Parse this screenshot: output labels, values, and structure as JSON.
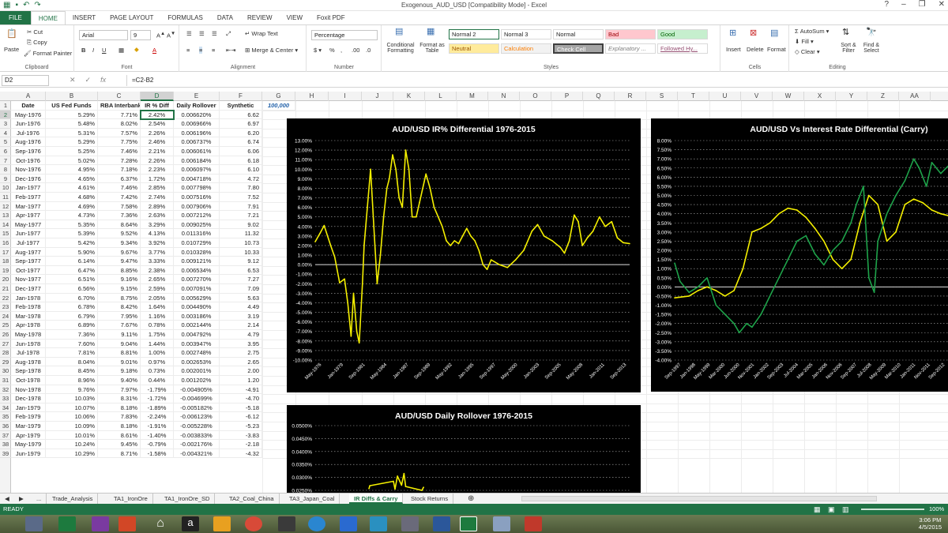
{
  "window": {
    "title": "Exogenous_AUD_USD  [Compatibility Mode] - Excel"
  },
  "ribbon_tabs": [
    "FILE",
    "HOME",
    "INSERT",
    "PAGE LAYOUT",
    "FORMULAS",
    "DATA",
    "REVIEW",
    "VIEW",
    "Foxit PDF"
  ],
  "ribbon": {
    "clipboard": {
      "paste": "Paste",
      "cut": "Cut",
      "copy": "Copy",
      "format_painter": "Format Painter",
      "label": "Clipboard"
    },
    "font": {
      "name": "Arial",
      "size": "9",
      "label": "Font"
    },
    "alignment": {
      "wrap": "Wrap Text",
      "merge": "Merge & Center",
      "label": "Alignment"
    },
    "number": {
      "format": "Percentage",
      "label": "Number"
    },
    "styles": {
      "conditional": "Conditional Formatting",
      "format_as_table": "Format as Table",
      "label": "Styles",
      "items": [
        {
          "name": "Normal 2",
          "bg": "#ffffff",
          "fg": "#222222"
        },
        {
          "name": "Normal 3",
          "bg": "#ffffff",
          "fg": "#222222"
        },
        {
          "name": "Normal",
          "bg": "#ffffff",
          "fg": "#222222"
        },
        {
          "name": "Bad",
          "bg": "#ffc7ce",
          "fg": "#9c0006"
        },
        {
          "name": "Good",
          "bg": "#c6efce",
          "fg": "#006100"
        },
        {
          "name": "Neutral",
          "bg": "#ffeb9c",
          "fg": "#9c5700"
        },
        {
          "name": "Calculation",
          "bg": "#f2f2f2",
          "fg": "#fa7d00"
        },
        {
          "name": "Check Cell",
          "bg": "#a5a5a5",
          "fg": "#ffffff"
        },
        {
          "name": "Explanatory ...",
          "bg": "#ffffff",
          "fg": "#7f7f7f"
        },
        {
          "name": "Followed Hy...",
          "bg": "#ffffff",
          "fg": "#954f72"
        }
      ]
    },
    "cells": {
      "insert": "Insert",
      "delete": "Delete",
      "format": "Format",
      "label": "Cells"
    },
    "editing": {
      "autosum": "AutoSum",
      "fill": "Fill",
      "clear": "Clear",
      "sort": "Sort & Filter",
      "find": "Find & Select",
      "label": "Editing"
    }
  },
  "formula_bar": {
    "name_box": "D2",
    "formula": "=C2-B2"
  },
  "columns": [
    "A",
    "B",
    "C",
    "D",
    "E",
    "F",
    "G",
    "H",
    "I",
    "J",
    "K",
    "L",
    "M",
    "N",
    "O",
    "P",
    "Q",
    "R",
    "S",
    "T",
    "U",
    "V",
    "W",
    "X",
    "Y",
    "Z",
    "AA"
  ],
  "header_row": [
    "Date",
    "US Fed Funds",
    "RBA Interbank",
    "IR % Diff",
    "Daily Rollover",
    "Synthetic",
    "100,000"
  ],
  "rows": [
    [
      "May-1976",
      "5.29%",
      "7.71%",
      "2.42%",
      "0.006620%",
      "6.62"
    ],
    [
      "Jun-1976",
      "5.48%",
      "8.02%",
      "2.54%",
      "0.006966%",
      "6.97"
    ],
    [
      "Jul-1976",
      "5.31%",
      "7.57%",
      "2.26%",
      "0.006196%",
      "6.20"
    ],
    [
      "Aug-1976",
      "5.29%",
      "7.75%",
      "2.46%",
      "0.006737%",
      "6.74"
    ],
    [
      "Sep-1976",
      "5.25%",
      "7.46%",
      "2.21%",
      "0.006061%",
      "6.06"
    ],
    [
      "Oct-1976",
      "5.02%",
      "7.28%",
      "2.26%",
      "0.006184%",
      "6.18"
    ],
    [
      "Nov-1976",
      "4.95%",
      "7.18%",
      "2.23%",
      "0.006097%",
      "6.10"
    ],
    [
      "Dec-1976",
      "4.65%",
      "6.37%",
      "1.72%",
      "0.004718%",
      "4.72"
    ],
    [
      "Jan-1977",
      "4.61%",
      "7.46%",
      "2.85%",
      "0.007798%",
      "7.80"
    ],
    [
      "Feb-1977",
      "4.68%",
      "7.42%",
      "2.74%",
      "0.007516%",
      "7.52"
    ],
    [
      "Mar-1977",
      "4.69%",
      "7.58%",
      "2.89%",
      "0.007906%",
      "7.91"
    ],
    [
      "Apr-1977",
      "4.73%",
      "7.36%",
      "2.63%",
      "0.007212%",
      "7.21"
    ],
    [
      "May-1977",
      "5.35%",
      "8.64%",
      "3.29%",
      "0.009025%",
      "9.02"
    ],
    [
      "Jun-1977",
      "5.39%",
      "9.52%",
      "4.13%",
      "0.011316%",
      "11.32"
    ],
    [
      "Jul-1977",
      "5.42%",
      "9.34%",
      "3.92%",
      "0.010729%",
      "10.73"
    ],
    [
      "Aug-1977",
      "5.90%",
      "9.67%",
      "3.77%",
      "0.010328%",
      "10.33"
    ],
    [
      "Sep-1977",
      "6.14%",
      "9.47%",
      "3.33%",
      "0.009121%",
      "9.12"
    ],
    [
      "Oct-1977",
      "6.47%",
      "8.85%",
      "2.38%",
      "0.006534%",
      "6.53"
    ],
    [
      "Nov-1977",
      "6.51%",
      "9.16%",
      "2.65%",
      "0.007270%",
      "7.27"
    ],
    [
      "Dec-1977",
      "6.56%",
      "9.15%",
      "2.59%",
      "0.007091%",
      "7.09"
    ],
    [
      "Jan-1978",
      "6.70%",
      "8.75%",
      "2.05%",
      "0.005629%",
      "5.63"
    ],
    [
      "Feb-1978",
      "6.78%",
      "8.42%",
      "1.64%",
      "0.004490%",
      "4.49"
    ],
    [
      "Mar-1978",
      "6.79%",
      "7.95%",
      "1.16%",
      "0.003186%",
      "3.19"
    ],
    [
      "Apr-1978",
      "6.89%",
      "7.67%",
      "0.78%",
      "0.002144%",
      "2.14"
    ],
    [
      "May-1978",
      "7.36%",
      "9.11%",
      "1.75%",
      "0.004792%",
      "4.79"
    ],
    [
      "Jun-1978",
      "7.60%",
      "9.04%",
      "1.44%",
      "0.003947%",
      "3.95"
    ],
    [
      "Jul-1978",
      "7.81%",
      "8.81%",
      "1.00%",
      "0.002748%",
      "2.75"
    ],
    [
      "Aug-1978",
      "8.04%",
      "9.01%",
      "0.97%",
      "0.002653%",
      "2.65"
    ],
    [
      "Sep-1978",
      "8.45%",
      "9.18%",
      "0.73%",
      "0.002001%",
      "2.00"
    ],
    [
      "Oct-1978",
      "8.96%",
      "9.40%",
      "0.44%",
      "0.001202%",
      "1.20"
    ],
    [
      "Nov-1978",
      "9.76%",
      "7.97%",
      "-1.79%",
      "-0.004905%",
      "-4.91"
    ],
    [
      "Dec-1978",
      "10.03%",
      "8.31%",
      "-1.72%",
      "-0.004699%",
      "-4.70"
    ],
    [
      "Jan-1979",
      "10.07%",
      "8.18%",
      "-1.89%",
      "-0.005182%",
      "-5.18"
    ],
    [
      "Feb-1979",
      "10.06%",
      "7.83%",
      "-2.24%",
      "-0.006123%",
      "-6.12"
    ],
    [
      "Mar-1979",
      "10.09%",
      "8.18%",
      "-1.91%",
      "-0.005228%",
      "-5.23"
    ],
    [
      "Apr-1979",
      "10.01%",
      "8.61%",
      "-1.40%",
      "-0.003833%",
      "-3.83"
    ],
    [
      "May-1979",
      "10.24%",
      "9.45%",
      "-0.79%",
      "-0.002176%",
      "-2.18"
    ],
    [
      "Jun-1979",
      "10.29%",
      "8.71%",
      "-1.58%",
      "-0.004321%",
      "-4.32"
    ]
  ],
  "chart_data": [
    {
      "type": "line",
      "title": "AUD/USD IR% Differential 1976-2015",
      "ylim": [
        -10,
        13
      ],
      "yticks": [
        "13.00%",
        "12.00%",
        "11.00%",
        "10.00%",
        "9.00%",
        "8.00%",
        "7.00%",
        "6.00%",
        "5.00%",
        "4.00%",
        "3.00%",
        "2.00%",
        "1.00%",
        "0.00%",
        "-1.00%",
        "-2.00%",
        "-3.00%",
        "-4.00%",
        "-5.00%",
        "-6.00%",
        "-7.00%",
        "-8.00%",
        "-9.00%",
        "-10.00%"
      ],
      "xticks": [
        "May-1976",
        "Jan-1979",
        "Sep-1981",
        "May-1984",
        "Jan-1987",
        "Sep-1989",
        "May-1992",
        "Jan-1995",
        "Sep-1997",
        "May-2000",
        "Jan-2003",
        "Sep-2005",
        "May-2008",
        "Jan-2011",
        "Sep-2013"
      ],
      "series": [
        {
          "color": "#f5f000",
          "x": [
            1976.4,
            1977.0,
            1977.5,
            1978.3,
            1978.8,
            1979.4,
            1980.0,
            1980.4,
            1980.8,
            1981.1,
            1981.5,
            1981.8,
            1982.2,
            1982.4,
            1982.8,
            1983.2,
            1983.6,
            1984.0,
            1984.4,
            1984.8,
            1985.2,
            1985.5,
            1985.9,
            1986.3,
            1986.7,
            1987.1,
            1987.5,
            1987.9,
            1988.3,
            1988.8,
            1989.2,
            1989.6,
            1990.0,
            1990.5,
            1991.0,
            1991.5,
            1992.0,
            1992.5,
            1993.0,
            1993.5,
            1994.0,
            1994.5,
            1995.0,
            1995.5,
            1996.0,
            1996.5,
            1997.0,
            1997.5,
            1998.0,
            1999.0,
            2000.0,
            2001.0,
            2002.0,
            2003.0,
            2003.7,
            2004.5,
            2005.5,
            2006.5,
            2007.0,
            2007.6,
            2008.2,
            2008.7,
            2009.2,
            2009.8,
            2010.5,
            2011.3,
            2012.0,
            2012.8,
            2013.5,
            2014.2,
            2015.0
          ],
          "y": [
            2.4,
            3.3,
            4.1,
            2.0,
            0.8,
            -1.9,
            -1.5,
            -4.0,
            -7.5,
            -3.0,
            -7.0,
            -8.2,
            -2.0,
            2.0,
            6.0,
            10.0,
            4.0,
            -2.0,
            1.0,
            5.0,
            8.0,
            9.0,
            11.5,
            10.0,
            7.0,
            6.0,
            12.0,
            10.0,
            5.0,
            5.0,
            6.5,
            8.0,
            9.5,
            8.0,
            6.0,
            5.0,
            4.0,
            2.5,
            2.0,
            2.5,
            2.2,
            3.0,
            3.8,
            3.0,
            2.5,
            1.5,
            0.0,
            -0.5,
            0.5,
            0.0,
            -0.3,
            0.5,
            1.5,
            3.5,
            4.2,
            3.0,
            2.5,
            1.8,
            1.2,
            2.5,
            5.2,
            4.5,
            2.0,
            2.8,
            3.5,
            5.0,
            4.0,
            4.5,
            2.8,
            2.3,
            2.2
          ]
        }
      ]
    },
    {
      "type": "line",
      "title": "AUD/USD Vs Interest Rate Differential (Carry)",
      "ylim": [
        -4,
        8
      ],
      "yticks": [
        "8.00%",
        "7.50%",
        "7.00%",
        "6.50%",
        "6.00%",
        "5.50%",
        "5.00%",
        "4.50%",
        "4.00%",
        "3.50%",
        "3.00%",
        "2.50%",
        "2.00%",
        "1.50%",
        "1.00%",
        "0.50%",
        "0.00%",
        "-0.50%",
        "-1.00%",
        "-1.50%",
        "-2.00%",
        "-2.50%",
        "-3.00%",
        "-3.50%",
        "-4.00%"
      ],
      "xticks": [
        "Sep-1997",
        "Jan-1998",
        "May-1999",
        "Mar-2000",
        "Jun-2000",
        "Nov-2001",
        "Jan-2002",
        "Sep-2003",
        "Jul-2004",
        "Mar-2005",
        "Jan-2006",
        "Nov-2006",
        "Sep-2007",
        "Jul-2008",
        "May-2009",
        "Mar-2010",
        "Jan-2011",
        "Nov-2011",
        "Sep-2012"
      ],
      "series": [
        {
          "color": "#f5f000",
          "x": [
            1997.7,
            1998.5,
            1999.0,
            1999.5,
            2000.0,
            2000.5,
            2001.0,
            2001.5,
            2002.0,
            2002.5,
            2003.0,
            2003.5,
            2004.0,
            2004.5,
            2005.0,
            2005.5,
            2006.0,
            2006.5,
            2007.0,
            2007.5,
            2008.0,
            2008.5,
            2009.0,
            2009.5,
            2010.0,
            2010.5,
            2011.0,
            2011.5,
            2012.0,
            2012.5,
            2012.9
          ],
          "y": [
            -0.6,
            -0.5,
            -0.2,
            0.0,
            -0.2,
            -0.5,
            -0.2,
            1.0,
            3.0,
            3.2,
            3.5,
            4.0,
            4.3,
            4.2,
            3.8,
            3.2,
            2.5,
            1.5,
            1.0,
            1.5,
            3.5,
            5.0,
            4.5,
            2.5,
            3.0,
            4.5,
            4.8,
            4.6,
            4.2,
            4.0,
            3.9
          ]
        },
        {
          "color": "#1ea34a",
          "x": [
            1997.7,
            1998.0,
            1998.5,
            1999.0,
            1999.5,
            2000.0,
            2000.5,
            2001.0,
            2001.3,
            2001.7,
            2002.0,
            2002.5,
            2003.0,
            2003.5,
            2004.0,
            2004.5,
            2005.0,
            2005.5,
            2006.0,
            2006.5,
            2007.0,
            2007.5,
            2007.8,
            2008.2,
            2008.5,
            2008.8,
            2009.0,
            2009.5,
            2010.0,
            2010.5,
            2011.0,
            2011.3,
            2011.7,
            2012.0,
            2012.5,
            2012.9
          ],
          "y": [
            1.3,
            0.3,
            -0.3,
            0.0,
            0.5,
            -1.0,
            -1.5,
            -2.0,
            -2.5,
            -2.0,
            -2.2,
            -1.5,
            -0.5,
            0.5,
            1.5,
            2.5,
            2.8,
            1.8,
            1.2,
            2.0,
            2.5,
            3.5,
            4.5,
            5.5,
            0.5,
            -0.3,
            2.5,
            4.0,
            5.0,
            5.8,
            7.0,
            6.5,
            5.5,
            6.8,
            6.2,
            6.6
          ]
        }
      ]
    },
    {
      "type": "line",
      "title": "AUD/USD Daily Rollover 1976-2015",
      "ylim": [
        0.025,
        0.05
      ],
      "yticks": [
        "0.0500%",
        "0.0450%",
        "0.0400%",
        "0.0350%",
        "0.0300%",
        "0.0250%"
      ],
      "series": [
        {
          "color": "#f5f000",
          "x": [
            1983.0,
            1983.1,
            1986.0,
            1986.2,
            1986.5,
            1987.0,
            1987.3,
            1987.5,
            1989.5,
            1989.7
          ],
          "y": [
            0.0257,
            0.0268,
            0.0285,
            0.0255,
            0.0305,
            0.027,
            0.0315,
            0.0265,
            0.025,
            0.0262
          ]
        }
      ]
    }
  ],
  "sheet_tabs": [
    "Trade_Analysis",
    "TA1_IronOre",
    "TA1_IronOre_SD",
    "TA2_Coal_China",
    "TA3_Japan_Coal",
    "IR Diffs & Carry",
    "Stock Returns"
  ],
  "active_sheet": "IR Diffs & Carry",
  "status": {
    "ready": "READY",
    "zoom": "100%"
  },
  "clock": {
    "time": "3:06 PM",
    "date": "4/5/2015"
  }
}
